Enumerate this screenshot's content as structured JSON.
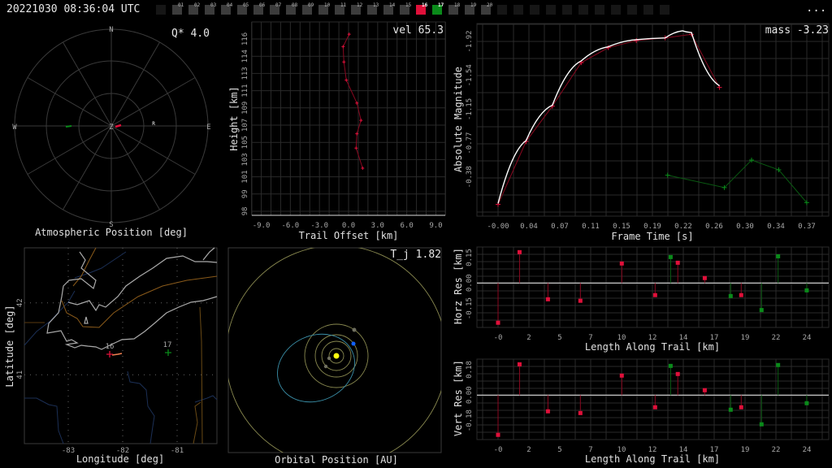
{
  "header": {
    "timestamp": "20221030 08:36:04 UTC",
    "more_label": "...",
    "stations": [
      {
        "label": "",
        "state": "off"
      },
      {
        "label": "01",
        "state": "on"
      },
      {
        "label": "02",
        "state": "on"
      },
      {
        "label": "03",
        "state": "on"
      },
      {
        "label": "04",
        "state": "on"
      },
      {
        "label": "05",
        "state": "on"
      },
      {
        "label": "06",
        "state": "on"
      },
      {
        "label": "07",
        "state": "on"
      },
      {
        "label": "08",
        "state": "on"
      },
      {
        "label": "09",
        "state": "on"
      },
      {
        "label": "10",
        "state": "on"
      },
      {
        "label": "11",
        "state": "on"
      },
      {
        "label": "12",
        "state": "on"
      },
      {
        "label": "13",
        "state": "on"
      },
      {
        "label": "14",
        "state": "on"
      },
      {
        "label": "15",
        "state": "on"
      },
      {
        "label": "16",
        "state": "red"
      },
      {
        "label": "17",
        "state": "green"
      },
      {
        "label": "18",
        "state": "on"
      },
      {
        "label": "19",
        "state": "on"
      },
      {
        "label": "20",
        "state": "on"
      },
      {
        "label": "",
        "state": "off"
      },
      {
        "label": "",
        "state": "off"
      },
      {
        "label": "",
        "state": "off"
      },
      {
        "label": "",
        "state": "off"
      },
      {
        "label": "",
        "state": "off"
      },
      {
        "label": "",
        "state": "off"
      },
      {
        "label": "",
        "state": "off"
      },
      {
        "label": "",
        "state": "off"
      },
      {
        "label": "",
        "state": "off"
      },
      {
        "label": "",
        "state": "off"
      },
      {
        "label": "",
        "state": "off"
      }
    ]
  },
  "colors": {
    "station_a": "#e0103a",
    "station_b": "#0a8a1a",
    "fit": "#ffffff",
    "grid": "#2a2a2a"
  },
  "polar": {
    "title": "Atmospheric Position [deg]",
    "q_label": "Q*  4.0",
    "n": "N",
    "s": "S",
    "e": "E",
    "w": "W",
    "z": "Z",
    "r": "R"
  },
  "map": {
    "title": "Longitude [deg]",
    "ylabel": "Latitude [deg]",
    "lon_ticks": [
      -83,
      -82,
      -81
    ],
    "lat_ticks": [
      42,
      41
    ],
    "markers": [
      {
        "label": "16",
        "color": "#e0103a"
      },
      {
        "label": "17",
        "color": "#0a8a1a"
      }
    ]
  },
  "orbit": {
    "title": "Orbital Position [AU]",
    "tj_label": "T_j 1.82"
  },
  "chart_data": [
    {
      "id": "height",
      "type": "line",
      "title": "vel 65.3",
      "xlabel": "Trail Offset [km]",
      "ylabel": "Height [km]",
      "xlim": [
        -10,
        10
      ],
      "xticks": [
        -9.0,
        -6.0,
        -3.0,
        0.0,
        3.0,
        6.0,
        9.0
      ],
      "xtick_labels": [
        "-9.0",
        "-6.0",
        "-3.0",
        "0.0",
        "3.0",
        "6.0",
        "9.0"
      ],
      "ytick_labels": [
        "116",
        "114",
        "113",
        "111",
        "109",
        "107",
        "105",
        "103",
        "101",
        "99",
        "98"
      ],
      "series": [
        {
          "name": "16",
          "x": [
            0.06,
            -0.56,
            -0.48,
            -0.23,
            0.86,
            1.28,
            0.86,
            0.78,
            1.45
          ],
          "y": [
            116.5,
            115.2,
            113.6,
            111.7,
            109.3,
            107.5,
            106.1,
            104.6,
            102.5
          ]
        }
      ]
    },
    {
      "id": "lightcurve",
      "type": "line",
      "title": "mass -3.23",
      "xlabel": "Frame Time [s]",
      "ylabel": "Absolute Magnitude",
      "xtick_labels": [
        "-0.00",
        "0.04",
        "0.07",
        "0.11",
        "0.15",
        "0.19",
        "0.22",
        "0.26",
        "0.30",
        "0.34",
        "0.37"
      ],
      "ytick_labels": [
        "-1.92",
        "-1.54",
        "-1.15",
        "-0.77",
        "-0.38"
      ],
      "series": [
        {
          "name": "16",
          "x": [
            0,
            0.034,
            0.066,
            0.101,
            0.134,
            0.168,
            0.203,
            0.235,
            0.269
          ],
          "y": [
            -0.08,
            -0.79,
            -1.19,
            -1.68,
            -1.85,
            -1.93,
            -1.96,
            -2.0,
            -1.4
          ]
        },
        {
          "name": "17",
          "x": [
            0.206,
            0.275,
            0.308,
            0.341,
            0.375
          ],
          "y": [
            -0.41,
            -0.27,
            -0.58,
            -0.47,
            -0.1
          ]
        },
        {
          "name": "fit",
          "x": [
            0,
            0.034,
            0.066,
            0.101,
            0.134,
            0.168,
            0.203,
            0.224,
            0.235,
            0.269
          ],
          "y": [
            -0.09,
            -0.8,
            -1.2,
            -1.7,
            -1.86,
            -1.94,
            -1.96,
            -2.04,
            -2.02,
            -1.42
          ]
        }
      ]
    },
    {
      "id": "horzres",
      "type": "scatter",
      "xlabel": "Length Along Trail [km]",
      "ylabel": "Horz Res [km]",
      "xtick_labels": [
        "-0",
        "2",
        "5",
        "7",
        "10",
        "12",
        "14",
        "17",
        "19",
        "22",
        "24"
      ],
      "ytick_labels": [
        "0.15",
        "0.00",
        "-0.15"
      ],
      "points": [
        {
          "station": "16",
          "x": 0.0,
          "y": -0.21
        },
        {
          "station": "16",
          "x": 1.65,
          "y": 0.163
        },
        {
          "station": "16",
          "x": 3.83,
          "y": -0.086
        },
        {
          "station": "16",
          "x": 6.32,
          "y": -0.094
        },
        {
          "station": "16",
          "x": 9.5,
          "y": 0.103
        },
        {
          "station": "16",
          "x": 12.06,
          "y": -0.064
        },
        {
          "station": "17",
          "x": 13.25,
          "y": 0.137
        },
        {
          "station": "16",
          "x": 13.8,
          "y": 0.107
        },
        {
          "station": "16",
          "x": 15.87,
          "y": 0.026
        },
        {
          "station": "17",
          "x": 17.86,
          "y": -0.069
        },
        {
          "station": "16",
          "x": 18.67,
          "y": -0.064
        },
        {
          "station": "17",
          "x": 20.23,
          "y": -0.143
        },
        {
          "station": "17",
          "x": 21.5,
          "y": 0.141
        },
        {
          "station": "17",
          "x": 23.7,
          "y": -0.039
        }
      ]
    },
    {
      "id": "vertres",
      "type": "scatter",
      "xlabel": "Length Along Trail [km]",
      "ylabel": "Vert Res [km]",
      "xtick_labels": [
        "-0",
        "2",
        "5",
        "7",
        "10",
        "12",
        "14",
        "17",
        "19",
        "22",
        "24"
      ],
      "ytick_labels": [
        "0.18",
        "0.00",
        "-0.18"
      ],
      "points": [
        {
          "station": "16",
          "x": 0.0,
          "y": -0.275
        },
        {
          "station": "16",
          "x": 1.65,
          "y": 0.213
        },
        {
          "station": "16",
          "x": 3.83,
          "y": -0.112
        },
        {
          "station": "16",
          "x": 6.32,
          "y": -0.124
        },
        {
          "station": "16",
          "x": 9.5,
          "y": 0.135
        },
        {
          "station": "16",
          "x": 12.06,
          "y": -0.084
        },
        {
          "station": "17",
          "x": 13.25,
          "y": 0.202
        },
        {
          "station": "16",
          "x": 13.8,
          "y": 0.146
        },
        {
          "station": "16",
          "x": 15.87,
          "y": 0.034
        },
        {
          "station": "17",
          "x": 17.86,
          "y": -0.101
        },
        {
          "station": "16",
          "x": 18.67,
          "y": -0.084
        },
        {
          "station": "17",
          "x": 20.23,
          "y": -0.202
        },
        {
          "station": "17",
          "x": 21.5,
          "y": 0.208
        },
        {
          "station": "17",
          "x": 23.7,
          "y": -0.056
        }
      ]
    }
  ]
}
